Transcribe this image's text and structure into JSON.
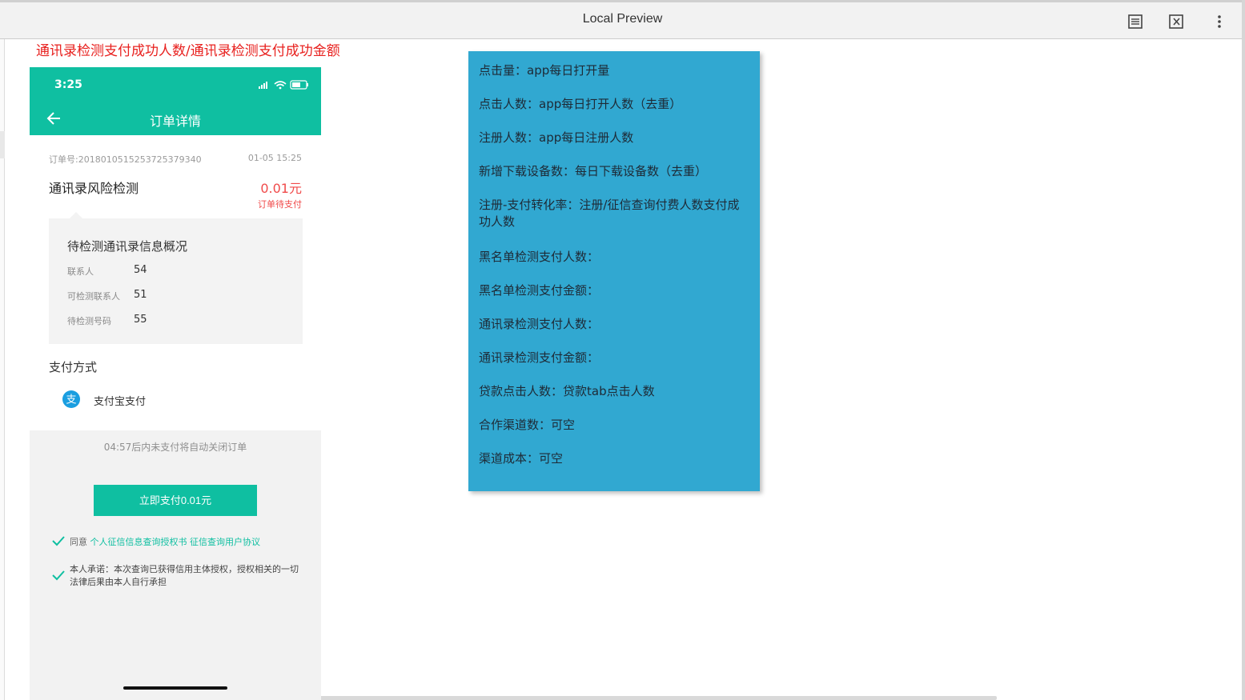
{
  "window": {
    "title": "Local Preview",
    "icons": [
      "reader-icon",
      "close-doc-icon",
      "more-vertical-icon"
    ]
  },
  "heading": "通讯录检测支付成功人数/通讯录检测支付成功金额",
  "phone": {
    "status_time": "3:25",
    "nav_title": "订单详情",
    "order_no": "订单号:201801051525372537934​0",
    "order_time": "01-05 15:25",
    "service_name": "通讯录风险检测",
    "amount": "0.01元",
    "pay_status": "订单待支付",
    "info": {
      "title": "待检测通讯录信息概况",
      "rows": [
        {
          "label": "联系人",
          "value": "54"
        },
        {
          "label": "可检测联系人",
          "value": "51"
        },
        {
          "label": "待检测号码",
          "value": "55"
        }
      ]
    },
    "pay_method_title": "支付方式",
    "pay_method": "支付宝支付",
    "countdown": "04:57后内未支付将自动关闭订单",
    "pay_button": "立即支付0.01元",
    "agree_prefix": "同意",
    "agree_link1": "个人征信信息查询授权书",
    "agree_link2": "征信查询用户协议",
    "commitment": "本人承诺：本次查询已获得信用主体授权，授权相关的一切法律后果由本人自行承担"
  },
  "definitions": [
    "点击量：app每日打开量",
    "点击人数：app每日打开人数（去重）",
    "注册人数：app每日注册人数",
    "新增下载设备数：每日下载设备数（去重）",
    "注册-支付转化率：注册/征信查询付费人数支付成功人数",
    "黑名单检测支付人数：",
    "黑名单检测支付金额：",
    "通讯录检测支付人数：",
    "通讯录检测支付金额：",
    "贷款点击人数：贷款tab点击人数",
    "合作渠道数：可空",
    "渠道成本：可空"
  ],
  "colors": {
    "accent": "#0fbfa1",
    "panel": "#31a8d1",
    "alert": "#f04a4a",
    "heading": "#e8201e"
  }
}
